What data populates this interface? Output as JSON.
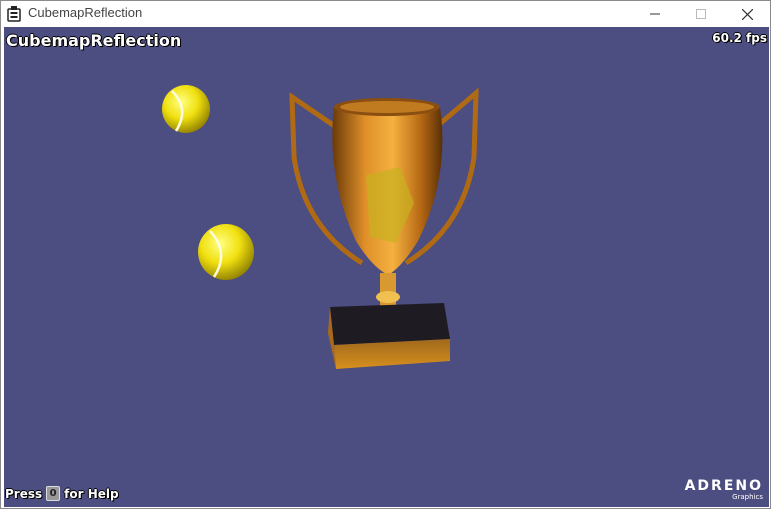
{
  "window": {
    "title": "CubemapReflection",
    "controls": [
      "minimize-icon",
      "maximize-icon",
      "close-icon"
    ]
  },
  "hud": {
    "app_title": "CubemapReflection",
    "fps": "60.2 fps",
    "help_prefix": "Press",
    "help_key": "0",
    "help_suffix": "for Help"
  },
  "logo": {
    "brand": "ADRENO",
    "sub": "Graphics"
  },
  "colors": {
    "background": "#4c4d80",
    "trophy": "#c8781c",
    "ball": "#e8e020"
  }
}
